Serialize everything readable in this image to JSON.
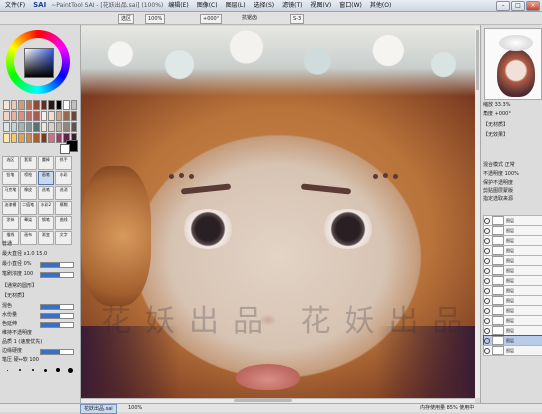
{
  "window": {
    "logo": "SAI",
    "title": "~PaintTool SAI - [花妖出品.sai] (100%)"
  },
  "menu": [
    "文件(F)",
    "编辑(E)",
    "图像(C)",
    "图层(L)",
    "选择(S)",
    "滤镜(T)",
    "视图(V)",
    "窗口(W)",
    "其他(O)"
  ],
  "toolbar": {
    "select_label": "选区",
    "zoom_value": "100%",
    "rotate_value": "+000°",
    "antialias_label": "抗锯齿",
    "stabilizer_value": "S-3"
  },
  "left_panel": {
    "tools": [
      "选区",
      "套索",
      "魔棒",
      "抓手",
      "铅笔",
      "喷枪",
      "画笔",
      "水彩",
      "马克笔",
      "橡皮",
      "选笔",
      "选消",
      "油漆桶",
      "二值笔",
      "水彩2",
      "模糊",
      "涂抹",
      "晕染",
      "钢笔",
      "曲线",
      "描线",
      "画布",
      "渐变",
      "文字"
    ],
    "mode_label": "普通",
    "size_label": "最大直径",
    "size_value": "x1.0  15.0",
    "min_size_label": "最小直径",
    "min_size_value": "0%",
    "density_label": "笔刷浓度",
    "density_value": "100",
    "shape_label": "【通常的圆形】",
    "texture_label": "【无材质】",
    "blend_label": "混色",
    "dilution_label": "水份量",
    "persistence_label": "色延伸",
    "keep_opacity_label": "维持不透明度",
    "blur_label": "模糊笔压",
    "quality_label": "品质",
    "quality_value": "1 (速度优先)",
    "edge_label": "边缘硬度",
    "min_density_label": "最小浓度",
    "max_pressure_label": "最大浓度笔压",
    "pressure_label": "笔压 硬⇔软",
    "pressure_value": "100"
  },
  "canvas": {
    "watermark": "花妖出品  花妖出品"
  },
  "right_panel": {
    "zoom_label": "缩放",
    "zoom_value": "33.3%",
    "angle_label": "角度",
    "angle_value": "+000°",
    "paper_label": "【无材质】",
    "effect_label": "【无效果】",
    "blend_mode_label": "混合模式",
    "blend_mode_value": "正常",
    "opacity_label": "不透明度",
    "opacity_value": "100%",
    "protect_label": "保护不透明度",
    "clip_label": "剪贴图层蒙版",
    "ref_label": "指定选取来源",
    "layers": [
      "图层",
      "图层",
      "图层",
      "图层",
      "图层",
      "图层",
      "图层",
      "图层",
      "图层",
      "图层",
      "图层",
      "图层",
      "图层",
      "图层"
    ]
  },
  "statusbar": {
    "file_tab": "花妖出品.sai",
    "zoom": "100%",
    "memory": "内存使用量 85% 使用中",
    "drive": "磁盘剩余空间"
  },
  "colors": {
    "accent": "#3a6fc7",
    "selected_tool": "#c8d8f0",
    "active_layer": "#b9cbea"
  },
  "swatches": [
    "#f4e6dc",
    "#e9c8b5",
    "#d29b80",
    "#b97256",
    "#8c4c37",
    "#5e2e23",
    "#2b1814",
    "#000000",
    "#ffffff",
    "#c0c0c0",
    "#f1d4c8",
    "#e8b0a3",
    "#d98f86",
    "#bf6b63",
    "#a95a54",
    "#f7efe4",
    "#ede0d2",
    "#c9a48b",
    "#986950",
    "#6a4534",
    "#dce6e5",
    "#c3d3d2",
    "#9fb6b5",
    "#7e9695",
    "#5b7271",
    "#eae7e2",
    "#d7d2cb",
    "#b8b1a8",
    "#8f877e",
    "#5a544d",
    "#ffe9a8",
    "#f6c86b",
    "#e3a34c",
    "#c98a4c",
    "#a3602f",
    "#7a3a20",
    "#d76c8a",
    "#9a3f66",
    "#5d2545",
    "#3a1d33"
  ]
}
